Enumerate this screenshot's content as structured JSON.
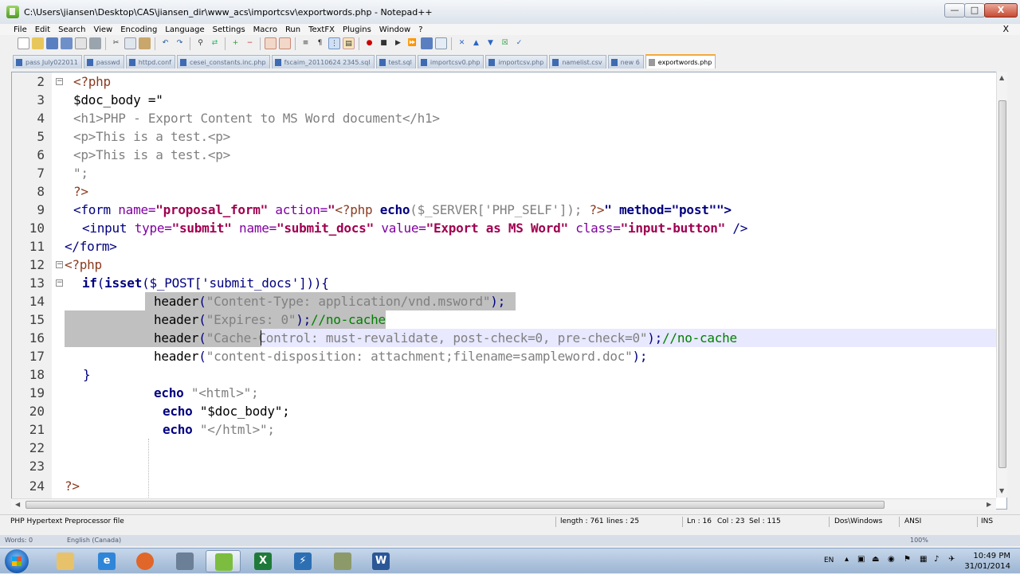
{
  "window": {
    "title": "C:\\Users\\jiansen\\Desktop\\CAS\\jiansen_dir\\www_acs\\importcsv\\exportwords.php - Notepad++",
    "minimize": "—",
    "maximize": "□",
    "close": "X"
  },
  "menu": {
    "items": [
      "File",
      "Edit",
      "Search",
      "View",
      "Encoding",
      "Language",
      "Settings",
      "Macro",
      "Run",
      "TextFX",
      "Plugins",
      "Window",
      "?"
    ],
    "close": "X"
  },
  "toolbar": {
    "icons": [
      "new-file-icon",
      "open-file-icon",
      "save-icon",
      "save-all-icon",
      "close-file-icon",
      "print-icon",
      "cut-icon",
      "copy-icon",
      "paste-icon",
      "undo-icon",
      "redo-icon",
      "find-icon",
      "replace-icon",
      "zoom-in-icon",
      "zoom-out-icon",
      "sync-v-icon",
      "sync-h-icon",
      "wrap-icon",
      "show-all-icon",
      "indent-guide-icon",
      "record-macro-icon",
      "stop-macro-icon",
      "play-macro-icon",
      "play-multiple-icon",
      "save-macro-icon",
      "trim-icon",
      "up-icon",
      "down-icon",
      "plugin-icon",
      "spell-icon"
    ]
  },
  "tabs": [
    {
      "label": "pass July022011",
      "active": false
    },
    {
      "label": "passwd",
      "active": false
    },
    {
      "label": "httpd.conf",
      "active": false
    },
    {
      "label": "cesei_constants.inc.php",
      "active": false
    },
    {
      "label": "fscaim_20110624 2345.sql",
      "active": false
    },
    {
      "label": "test.sql",
      "active": false
    },
    {
      "label": "importcsv0.php",
      "active": false
    },
    {
      "label": "importcsv.php",
      "active": false
    },
    {
      "label": "namelist.csv",
      "active": false
    },
    {
      "label": "new 6",
      "active": false
    },
    {
      "label": "exportwords.php",
      "active": true
    }
  ],
  "editor": {
    "line_numbers": [
      "2",
      "3",
      "4",
      "5",
      "6",
      "7",
      "8",
      "9",
      "10",
      "11",
      "12",
      "13",
      "14",
      "15",
      "16",
      "17",
      "18",
      "19",
      "20",
      "21",
      "22",
      "23",
      "24"
    ],
    "lines": {
      "l2": "<?php",
      "l3": "$doc_body =\"",
      "l4": "<h1>PHP - Export Content to MS Word document</h1>",
      "l5": "<p>This is a test.<p>",
      "l6": "<p>This is a test.<p>",
      "l7": "\";",
      "l8": "?>",
      "l9_a": "<form ",
      "l9_b": "name=",
      "l9_c": "\"proposal_form\"",
      "l9_d": " action=",
      "l9_e": "\"",
      "l9_f": "<?php",
      "l9_g": " echo",
      "l9_h": "($_SERVER['PHP_SELF']); ",
      "l9_i": "?>",
      "l9_j": "\" method=\"post\"\">",
      "l10_a": "<input ",
      "l10_b": "type=",
      "l10_c": "\"submit\"",
      "l10_d": " name=",
      "l10_e": "\"submit_docs\"",
      "l10_f": " value=",
      "l10_g": "\"Export as MS Word\"",
      "l10_h": " class=",
      "l10_i": "\"input-button\"",
      "l10_j": " />",
      "l11": "</form>",
      "l12": "<?php",
      "l13_a": "if",
      "l13_b": "(",
      "l13_c": "isset",
      "l13_d": "($_POST['submit_docs'])){",
      "l14_a": "header",
      "l14_b": "(",
      "l14_c": "\"Content-Type: application/vnd.msword\"",
      "l14_d": ");",
      "l15_a": "header",
      "l15_b": "(",
      "l15_c": "\"Expires: 0\"",
      "l15_d": ");",
      "l15_e": "//no-cache",
      "l16_a": "header",
      "l16_b": "(",
      "l16_c": "\"Cache-Control: must-revalidate, post-check=0, pre-check=0\"",
      "l16_d": ");",
      "l16_e": "//no-cache",
      "l17_a": "header",
      "l17_b": "(",
      "l17_c": "\"content-disposition: attachment;filename=sampleword.doc\"",
      "l17_d": ");",
      "l18": "}",
      "l19_a": "echo",
      "l19_b": " \"<html>\";",
      "l20_a": "echo",
      "l20_b": " \"$doc_body\";",
      "l21_a": "echo",
      "l21_b": " \"</html>\";",
      "l24": "?>"
    }
  },
  "statusbar": {
    "filetype": "PHP Hypertext Preprocessor file",
    "length": "length : 761",
    "lines": "lines : 25",
    "ln": "Ln : 16",
    "col": "Col : 23",
    "sel": "Sel : 115",
    "eol": "Dos\\Windows",
    "encoding": "ANSI",
    "mode": "INS"
  },
  "wordbar": {
    "words": "Words: 0",
    "lang": "English (Canada)",
    "zoom": "100%"
  },
  "taskbar": {
    "apps": [
      "explorer-icon",
      "ie-icon",
      "firefox-icon",
      "network-icon",
      "notepadpp-icon",
      "excel-icon",
      "filezilla-icon",
      "stack-icon",
      "word-icon"
    ],
    "lang": "EN",
    "time": "10:49 PM",
    "date": "31/01/2014"
  },
  "colors": {
    "keyword": "#000080",
    "string": "#808080",
    "comment": "#008000",
    "selection": "#c0c0c0",
    "active_tab_accent": "#f4a93b"
  }
}
